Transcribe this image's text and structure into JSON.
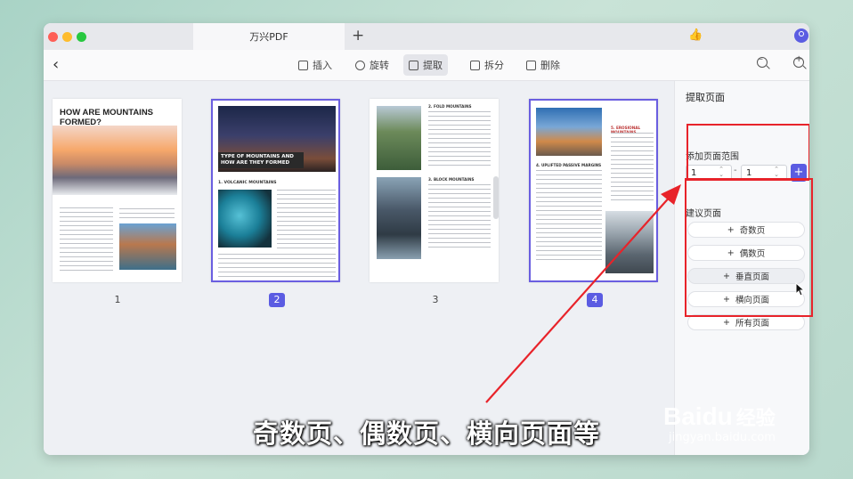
{
  "app": {
    "tab_title": "万兴PDF",
    "new_tab": "+"
  },
  "toolbar": {
    "back": "‹",
    "insert": "插入",
    "rotate": "旋转",
    "extract": "提取",
    "split": "拆分",
    "delete": "删除"
  },
  "pages": [
    {
      "number": "1",
      "selected": false,
      "heading": "HOW ARE MOUNTAINS FORMED?"
    },
    {
      "number": "2",
      "selected": true,
      "heading": "TYPE OF MOUNTAINS AND HOW ARE THEY FORMED",
      "section": "1. VOLCANIC MOUNTAINS"
    },
    {
      "number": "3",
      "selected": false,
      "section_a": "2. FOLD MOUNTAINS",
      "section_b": "3. BLOCK MOUNTAINS"
    },
    {
      "number": "4",
      "selected": true,
      "section_a": "5. EROSIONAL MOUNTAINS",
      "section_b": "4. UPLIFTED PASSIVE MARGINS"
    }
  ],
  "panel": {
    "title": "提取页面",
    "range_label": "添加页面范围",
    "range_from": "1",
    "range_dash": "-",
    "range_to": "1",
    "add": "+",
    "suggest_label": "建议页面",
    "options": [
      "奇数页",
      "偶数页",
      "垂直页面",
      "横向页面",
      "所有页面"
    ]
  },
  "caption": "奇数页、偶数页、横向页面等",
  "watermark": {
    "brand": "Baidu",
    "brand_cn": "经验",
    "url": "jingyan.baidu.com"
  },
  "colors": {
    "accent": "#5b5ce2",
    "highlight": "#e8232a"
  }
}
